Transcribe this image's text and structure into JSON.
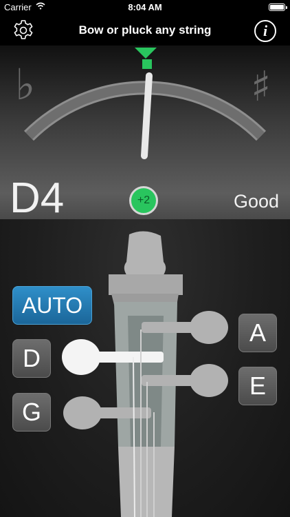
{
  "status_bar": {
    "carrier": "Carrier",
    "time": "8:04 AM"
  },
  "navbar": {
    "title": "Bow or pluck any string",
    "info_label": "i",
    "settings_icon": "gear-icon",
    "info_icon": "info-icon"
  },
  "tuner": {
    "flat_symbol": "♭",
    "sharp_symbol": "♯",
    "note": "D4",
    "cents": "+2",
    "cents_value": 2,
    "status": "Good",
    "accent_color": "#29c55e"
  },
  "strings": {
    "auto_label": "AUTO",
    "d_label": "D",
    "g_label": "G",
    "a_label": "A",
    "e_label": "E",
    "auto_color": "#1b6699",
    "selected": "D"
  }
}
